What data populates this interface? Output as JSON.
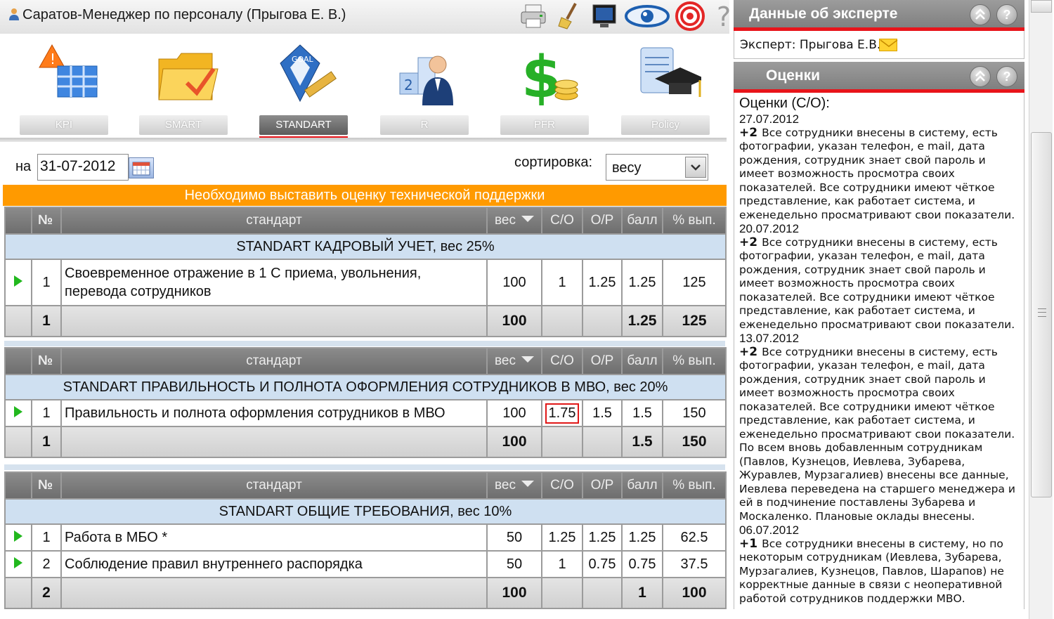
{
  "app": {
    "title": "Саратов-Менеджер по персоналу  (Прыгова Е. В.)"
  },
  "toolbar_icons": [
    "printer-icon",
    "broom-icon",
    "monitor-icon",
    "eye-icon",
    "target-icon",
    "help-icon"
  ],
  "modules": [
    {
      "label": "KPI",
      "icon": "kpi-icon",
      "active": false
    },
    {
      "label": "SMART",
      "icon": "folder-icon",
      "active": false
    },
    {
      "label": "STANDART",
      "icon": "goal-icon",
      "active": true
    },
    {
      "label": "R",
      "icon": "ranking-icon",
      "active": false
    },
    {
      "label": "PFR",
      "icon": "dollar-icon",
      "active": false
    },
    {
      "label": "Policy",
      "icon": "graduation-icon",
      "active": false
    }
  ],
  "filters": {
    "date_label": "на",
    "date_value": "31-07-2012",
    "sort_label": "сортировка:",
    "sort_value": "весу"
  },
  "banner": "Необходимо выставить оценку технической поддержки",
  "columns": {
    "no": "№",
    "standard": "стандарт",
    "weight": "вес",
    "so": "С/О",
    "op": "О/Р",
    "score": "балл",
    "pct": "% вып."
  },
  "sections": [
    {
      "title": "STANDART КАДРОВЫЙ УЧЕТ, вес 25%",
      "rows": [
        {
          "no": "1",
          "name": "Своевременное отражение в 1 С приема, увольнения, перевода сотрудников",
          "weight": "100",
          "so": "1",
          "op": "1.25",
          "score": "1.25",
          "pct": "125"
        }
      ],
      "total": {
        "no": "1",
        "weight": "100",
        "so": "",
        "op": "",
        "score": "1.25",
        "pct": "125"
      }
    },
    {
      "title": "STANDART ПРАВИЛЬНОСТЬ И ПОЛНОТА ОФОРМЛЕНИЯ СОТРУДНИКОВ В МВО, вес 20%",
      "rows": [
        {
          "no": "1",
          "name": "Правильность и полнота оформления сотрудников в МВО",
          "weight": "100",
          "so": "1.75",
          "op": "1.5",
          "score": "1.5",
          "pct": "150"
        }
      ],
      "total": {
        "no": "1",
        "weight": "100",
        "so": "",
        "op": "",
        "score": "1.5",
        "pct": "150"
      }
    },
    {
      "title": "STANDART ОБЩИЕ ТРЕБОВАНИЯ, вес 10%",
      "rows": [
        {
          "no": "1",
          "name": "Работа в МБО *",
          "weight": "50",
          "so": "1.25",
          "op": "1.25",
          "score": "1.25",
          "pct": "62.5"
        },
        {
          "no": "2",
          "name": "Соблюдение правил внутреннего распорядка",
          "weight": "50",
          "so": "1",
          "op": "0.75",
          "score": "0.75",
          "pct": "37.5"
        }
      ],
      "total": {
        "no": "2",
        "weight": "100",
        "so": "",
        "op": "",
        "score": "1",
        "pct": "100"
      }
    }
  ],
  "expert_panel": {
    "title": "Данные об эксперте",
    "expert": "Эксперт: Прыгова Е.В."
  },
  "scores_panel": {
    "title": "Оценки",
    "heading": "Оценки (С/О):",
    "entries": [
      {
        "date": "27.07.2012",
        "score": "+2",
        "text": "Все сотрудники внесены в систему, есть фотографии, указан телефон, е mail, дата рождения, сотрудник знает свой пароль и имеет возможность просмотра своих показателей. Все сотрудники имеют чёткое представление, как работает система, и еженедельно просматривают свои показатели."
      },
      {
        "date": "20.07.2012",
        "score": "+2",
        "text": "Все сотрудники внесены в систему, есть фотографии, указан телефон, е mail, дата рождения, сотрудник знает свой пароль и имеет возможность просмотра своих показателей. Все сотрудники имеют чёткое представление, как работает система, и еженедельно просматривают свои показатели."
      },
      {
        "date": "13.07.2012",
        "score": "+2",
        "text": "Все сотрудники внесены в систему, есть фотографии, указан телефон, е mail, дата рождения, сотрудник знает свой пароль и имеет возможность просмотра своих показателей. Все сотрудники имеют чёткое представление, как работает система, и еженедельно просматривают свои показатели. По всем вновь добавленным сотрудникам (Павлов, Кузнецов, Иевлева, Зубарева, Журавлев, Мурзагалиев) внесены все данные, Иевлева переведена на старшего менеджера и ей в подчинение поставлены Зубарева и Москаленко. Плановые оклады внесены."
      },
      {
        "date": "06.07.2012",
        "score": "+1",
        "text": "Все сотрудники внесены в систему, но по некоторым сотрудникам (Иевлева, Зубарева, Мурзагалиев, Кузнецов, Павлов, Шарапов) не корректные данные в связи с неоперативной работой сотрудников поддержки МВО."
      }
    ]
  },
  "colors": {
    "accent_red": "#e8141a",
    "banner_orange": "#ff9a00",
    "section_blue": "#cfe0f1",
    "play_green": "#22b81e"
  }
}
